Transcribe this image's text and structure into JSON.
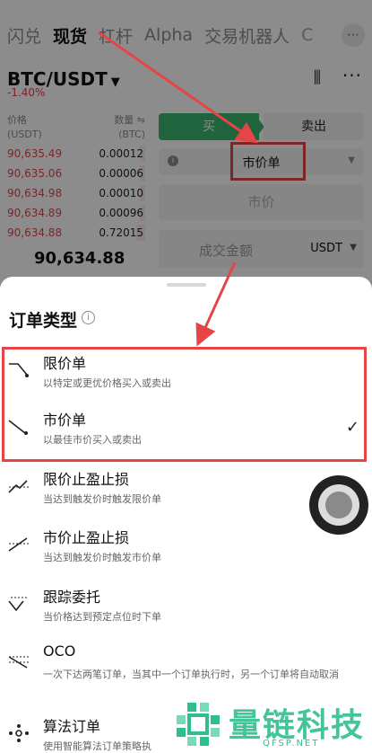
{
  "top_tabs": [
    "闪兑",
    "现货",
    "杠杆",
    "Alpha",
    "交易机器人",
    "C"
  ],
  "active_tab": "现货",
  "more_icon": "⋯",
  "pair": {
    "name": "BTC/USDT",
    "change": "-1.40%"
  },
  "orderbook": {
    "header_left": [
      "价格",
      "(USDT)"
    ],
    "header_right": [
      "数量 ⇋",
      "(BTC)"
    ],
    "rows": [
      {
        "price": "90,635.49",
        "qty": "0.00012",
        "depth": 0.04
      },
      {
        "price": "90,635.06",
        "qty": "0.00006",
        "depth": 0.04
      },
      {
        "price": "90,634.98",
        "qty": "0.00010",
        "depth": 0.04
      },
      {
        "price": "90,634.89",
        "qty": "0.00096",
        "depth": 0.04
      },
      {
        "price": "90,634.88",
        "qty": "0.72015",
        "depth": 0.06
      }
    ],
    "last_price": "90,634.88"
  },
  "form": {
    "buy_label": "买",
    "sell_label": "卖出",
    "order_type_value": "市价单",
    "price_placeholder": "市价",
    "amount_label": "成交金额",
    "amount_unit": "USDT"
  },
  "sheet": {
    "title": "订单类型",
    "options": [
      {
        "name": "限价单",
        "desc": "以特定或更优价格买入或卖出",
        "icon": "limit-order-icon",
        "selected": false
      },
      {
        "name": "市价单",
        "desc": "以最佳市价买入或卖出",
        "icon": "market-order-icon",
        "selected": true
      },
      {
        "name": "限价止盈止损",
        "desc": "当达到触发价时触发限价单",
        "icon": "stop-limit-icon",
        "selected": false
      },
      {
        "name": "市价止盈止损",
        "desc": "当达到触发价时触发市价单",
        "icon": "stop-market-icon",
        "selected": false
      },
      {
        "name": "跟踪委托",
        "desc": "当价格达到预定点位时下单",
        "icon": "trailing-order-icon",
        "selected": false
      },
      {
        "name": "OCO",
        "desc": "一次下达两笔订单，当其中一个订单执行时，另一个订单将自动取消",
        "icon": "oco-icon",
        "selected": false
      },
      {
        "name": "算法订单",
        "desc": "使用智能算法订单策略执",
        "icon": "algo-order-icon",
        "selected": false
      }
    ]
  },
  "watermark": {
    "text": "量链科技",
    "sub": "QFSP.NET"
  },
  "colors": {
    "buy": "#3ab66f",
    "sell_price": "#e8414b",
    "annotation": "#e64545",
    "watermark": "#2fbf8f"
  }
}
